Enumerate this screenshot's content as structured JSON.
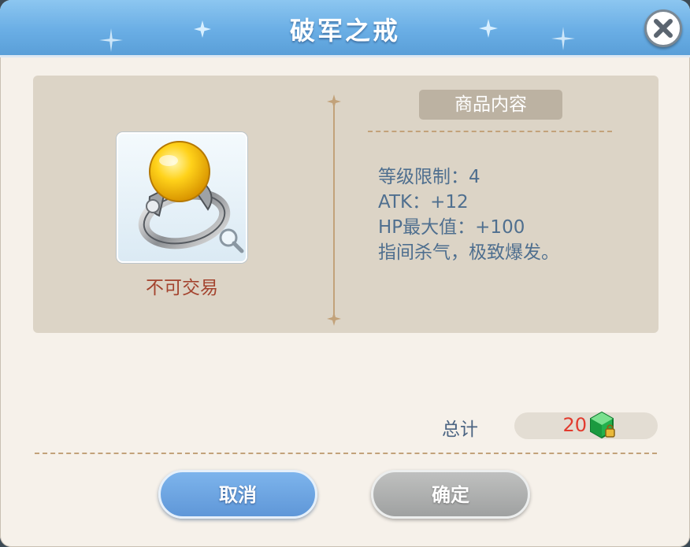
{
  "dialog": {
    "title": "破军之戒",
    "close_icon": "close-icon"
  },
  "item": {
    "name": "破军之戒",
    "icon": "ring-icon",
    "zoom_icon": "magnifier-icon",
    "trade_status": "不可交易"
  },
  "details": {
    "section_title": "商品内容",
    "lines": [
      "等级限制：4",
      "ATK：+12",
      "HP最大值：+100",
      "指间杀气，极致爆发。"
    ]
  },
  "total": {
    "label": "总计",
    "value": "20",
    "currency_icon": "green-gem-icon"
  },
  "buttons": {
    "cancel": "取消",
    "confirm": "确定"
  },
  "colors": {
    "header": "#6aaee5",
    "panel": "#dcd4c6",
    "accent_text": "#4f6f8f",
    "price": "#e23b2e",
    "trade_status": "#a4442f"
  }
}
